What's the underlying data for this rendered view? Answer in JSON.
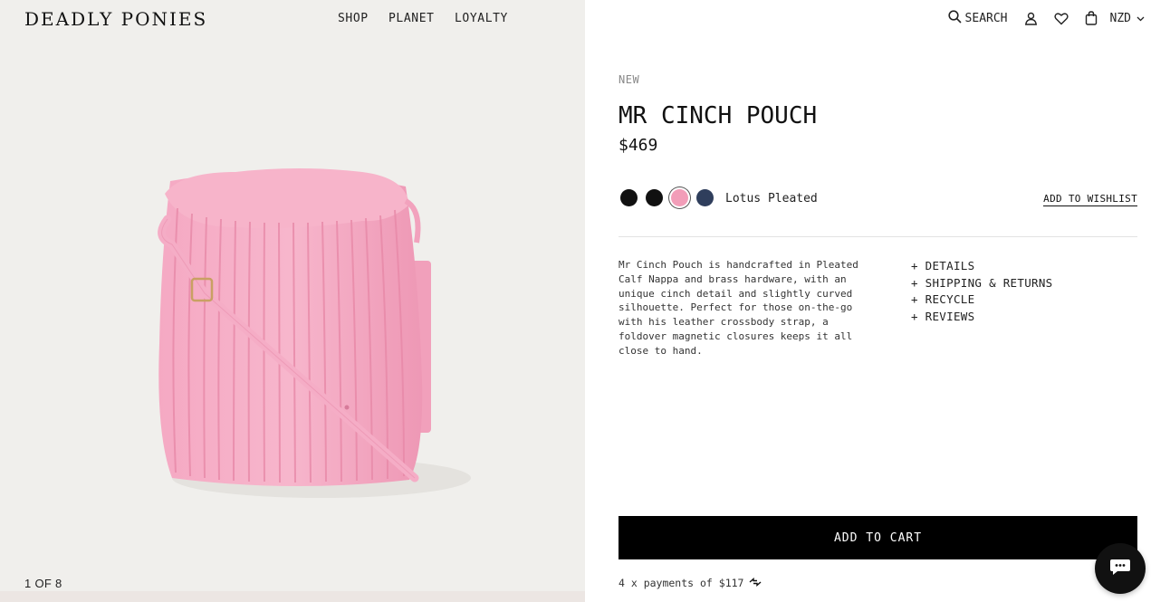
{
  "header": {
    "brand": "DEADLY PONIES",
    "nav": [
      "SHOP",
      "PLANET",
      "LOYALTY"
    ],
    "search_label": "SEARCH",
    "currency": "NZD"
  },
  "gallery": {
    "counter": "1 OF 8",
    "product_color": "#f4a3c0"
  },
  "product": {
    "badge": "NEW",
    "title": "MR CINCH POUCH",
    "price": "$469",
    "swatches": [
      {
        "color": "#111111",
        "selected": false
      },
      {
        "color": "#111111",
        "selected": false
      },
      {
        "color": "#f29db8",
        "selected": true
      },
      {
        "color": "#2f3e5c",
        "selected": false
      }
    ],
    "selected_color_name": "Lotus Pleated",
    "wishlist_label": "ADD TO WISHLIST",
    "description": "Mr Cinch Pouch is handcrafted in Pleated Calf Nappa and brass hardware, with an unique cinch detail and slightly curved silhouette. Perfect for those on-the-go with his leather crossbody strap, a foldover magnetic closures keeps it all close to hand.",
    "accordion": [
      "+ DETAILS",
      "+ SHIPPING & RETURNS",
      "+ RECYCLE",
      "+ REVIEWS"
    ],
    "add_to_cart_label": "ADD TO CART",
    "payments_text": "4 x payments of $117"
  }
}
